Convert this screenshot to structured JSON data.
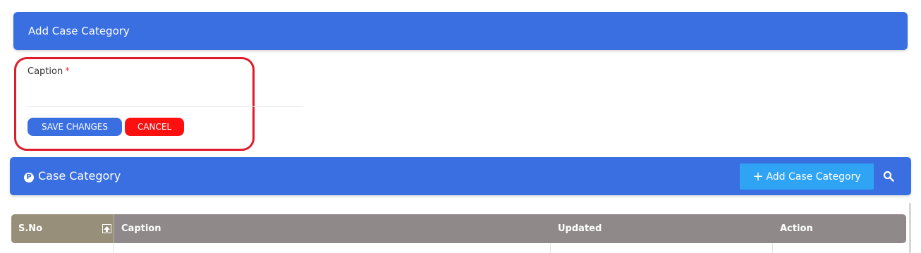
{
  "add_panel": {
    "title": "Add Case Category"
  },
  "form": {
    "caption_label": "Caption",
    "required_mark": "*",
    "caption_value": "",
    "save_label": "SAVE CHANGES",
    "cancel_label": "CANCEL"
  },
  "list_panel": {
    "title": "Case Category",
    "add_button_label": "Add Case Category"
  },
  "table": {
    "columns": [
      "S.No",
      "Caption",
      "Updated",
      "Action"
    ]
  },
  "colors": {
    "primary": "#3a6fe2",
    "danger": "#ff1010",
    "highlight_border": "#e01b2b",
    "add_button": "#2fa4f5",
    "grid_header": "#8f8a89"
  }
}
